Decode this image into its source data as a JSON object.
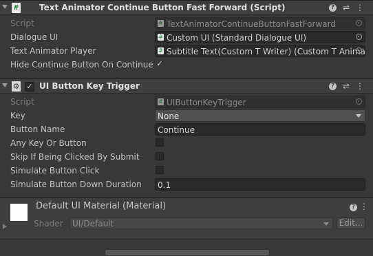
{
  "component1": {
    "title": "Text Animator Continue Button Fast Forward (Script)",
    "icon_glyph": "#",
    "enabled": true,
    "fields": {
      "script_label": "Script",
      "script_value": "TextAnimatorContinueButtonFastForward",
      "dialogue_ui_label": "Dialogue UI",
      "dialogue_ui_value": "Custom UI (Standard Dialogue UI)",
      "text_animator_player_label": "Text Animator Player",
      "text_animator_player_value": "Subtitle Text(Custom T Writer) (Custom T Animat",
      "hide_continue_label": "Hide Continue Button On Continue",
      "hide_continue_checked": true
    }
  },
  "component2": {
    "title": "UI Button Key Trigger",
    "enabled": true,
    "fields": {
      "script_label": "Script",
      "script_value": "UIButtonKeyTrigger",
      "key_label": "Key",
      "key_value": "None",
      "button_name_label": "Button Name",
      "button_name_value": "Continue",
      "any_key_label": "Any Key Or Button",
      "any_key_checked": false,
      "skip_label": "Skip If Being Clicked By Submit",
      "skip_checked": false,
      "simulate_click_label": "Simulate Button Click",
      "simulate_click_checked": false,
      "simulate_duration_label": "Simulate Button Down Duration",
      "simulate_duration_value": "0.1"
    }
  },
  "material": {
    "title": "Default UI Material (Material)",
    "shader_label": "Shader",
    "shader_value": "UI/Default",
    "edit_label": "Edit..."
  },
  "header_buttons": {
    "help": "?",
    "presets": "⇌",
    "menu": "⋮",
    "checkmark": "✓"
  },
  "colors": {
    "background": "#383838",
    "header": "#3e3e3e",
    "field": "#2a2a2a",
    "text": "#c4c4c4"
  }
}
